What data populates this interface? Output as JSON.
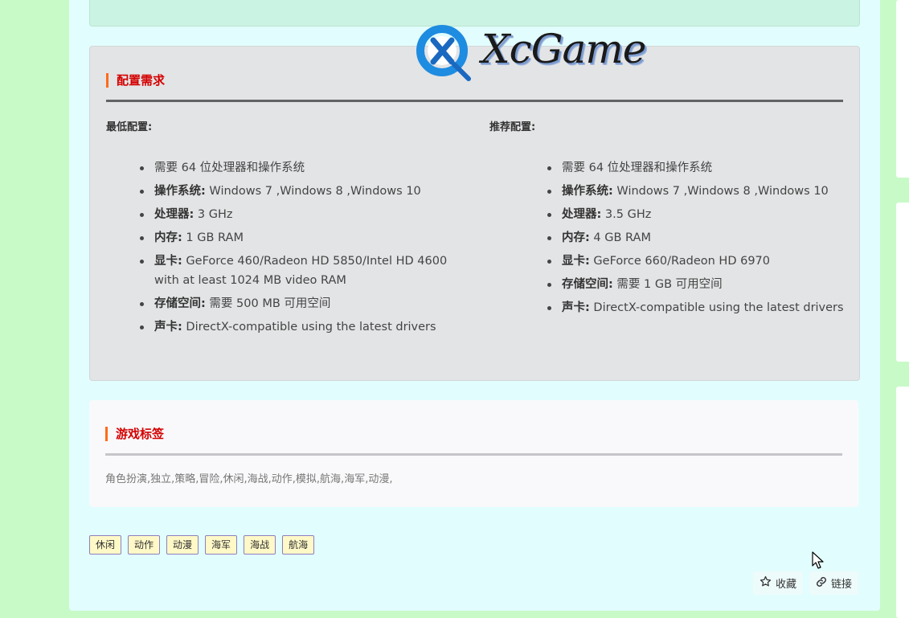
{
  "config": {
    "title": "配置需求",
    "min_label": "最低配置:",
    "rec_label": "推荐配置:",
    "min": [
      {
        "key": "",
        "value": "需要 64 位处理器和操作系统"
      },
      {
        "key": "操作系统:",
        "value": " Windows 7 ,Windows 8 ,Windows 10"
      },
      {
        "key": "处理器:",
        "value": " 3 GHz"
      },
      {
        "key": "内存:",
        "value": " 1 GB RAM"
      },
      {
        "key": "显卡:",
        "value": " GeForce 460/Radeon HD 5850/Intel HD 4600 with at least 1024 MB video RAM"
      },
      {
        "key": "存储空间:",
        "value": " 需要 500 MB 可用空间"
      },
      {
        "key": "声卡:",
        "value": " DirectX-compatible using the latest drivers"
      }
    ],
    "rec": [
      {
        "key": "",
        "value": "需要 64 位处理器和操作系统"
      },
      {
        "key": "操作系统:",
        "value": " Windows 7 ,Windows 8 ,Windows 10"
      },
      {
        "key": "处理器:",
        "value": " 3.5 GHz"
      },
      {
        "key": "内存:",
        "value": " 4 GB RAM"
      },
      {
        "key": "显卡:",
        "value": " GeForce 660/Radeon HD 6970"
      },
      {
        "key": "存储空间:",
        "value": " 需要 1 GB 可用空间"
      },
      {
        "key": "声卡:",
        "value": " DirectX-compatible using the latest drivers"
      }
    ]
  },
  "tags_section": {
    "title": "游戏标签",
    "text": "角色扮演,独立,策略,冒险,休闲,海战,动作,模拟,航海,海军,动漫,"
  },
  "tag_chips": [
    "休闲",
    "动作",
    "动漫",
    "海军",
    "海战",
    "航海"
  ],
  "actions": {
    "favorite": "收藏",
    "link": "链接"
  },
  "logo": {
    "text": "XcGame",
    "icon": "xcgame-logo-icon"
  },
  "colors": {
    "background": "#c8fac8",
    "panel": "#e2fdfd",
    "title_red": "#d40000",
    "title_bar": "#ff6a1a",
    "tag_bg": "#fff8c7",
    "tag_border": "#8c7fc0"
  }
}
